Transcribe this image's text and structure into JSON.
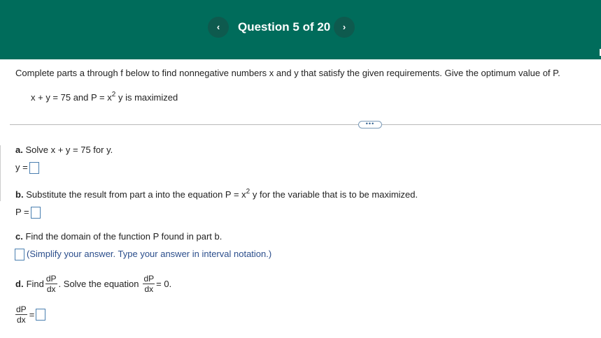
{
  "header": {
    "title": "Question 5 of 20",
    "prev_glyph": "‹",
    "next_glyph": "›",
    "background_color": "#006c5b",
    "button_color": "#0e5a4e"
  },
  "question": {
    "intro": "Complete parts a through f below to find nonnegative numbers x and y that satisfy the given requirements. Give the optimum value of P.",
    "requirement_before": "x + y = 75 and P = x",
    "requirement_exp": "2",
    "requirement_after": "y is maximized"
  },
  "more_button": "•••",
  "parts": {
    "a": {
      "letter": "a.",
      "text": "Solve x + y = 75 for y.",
      "answer_label": "y ="
    },
    "b": {
      "letter": "b.",
      "text_before": "Substitute the result from part a into the equation P = x",
      "exp": "2",
      "text_after": "y for the variable that is to be maximized.",
      "answer_label": "P ="
    },
    "c": {
      "letter": "c.",
      "text": "Find the domain of the function P found in part b.",
      "hint": "(Simplify your answer. Type your answer in interval notation.)"
    },
    "d": {
      "letter": "d.",
      "find": "Find",
      "frac_num": "dP",
      "frac_den": "dx",
      "mid_text": ". Solve the equation",
      "eq_text": "= 0.",
      "answer_eq": "="
    }
  }
}
